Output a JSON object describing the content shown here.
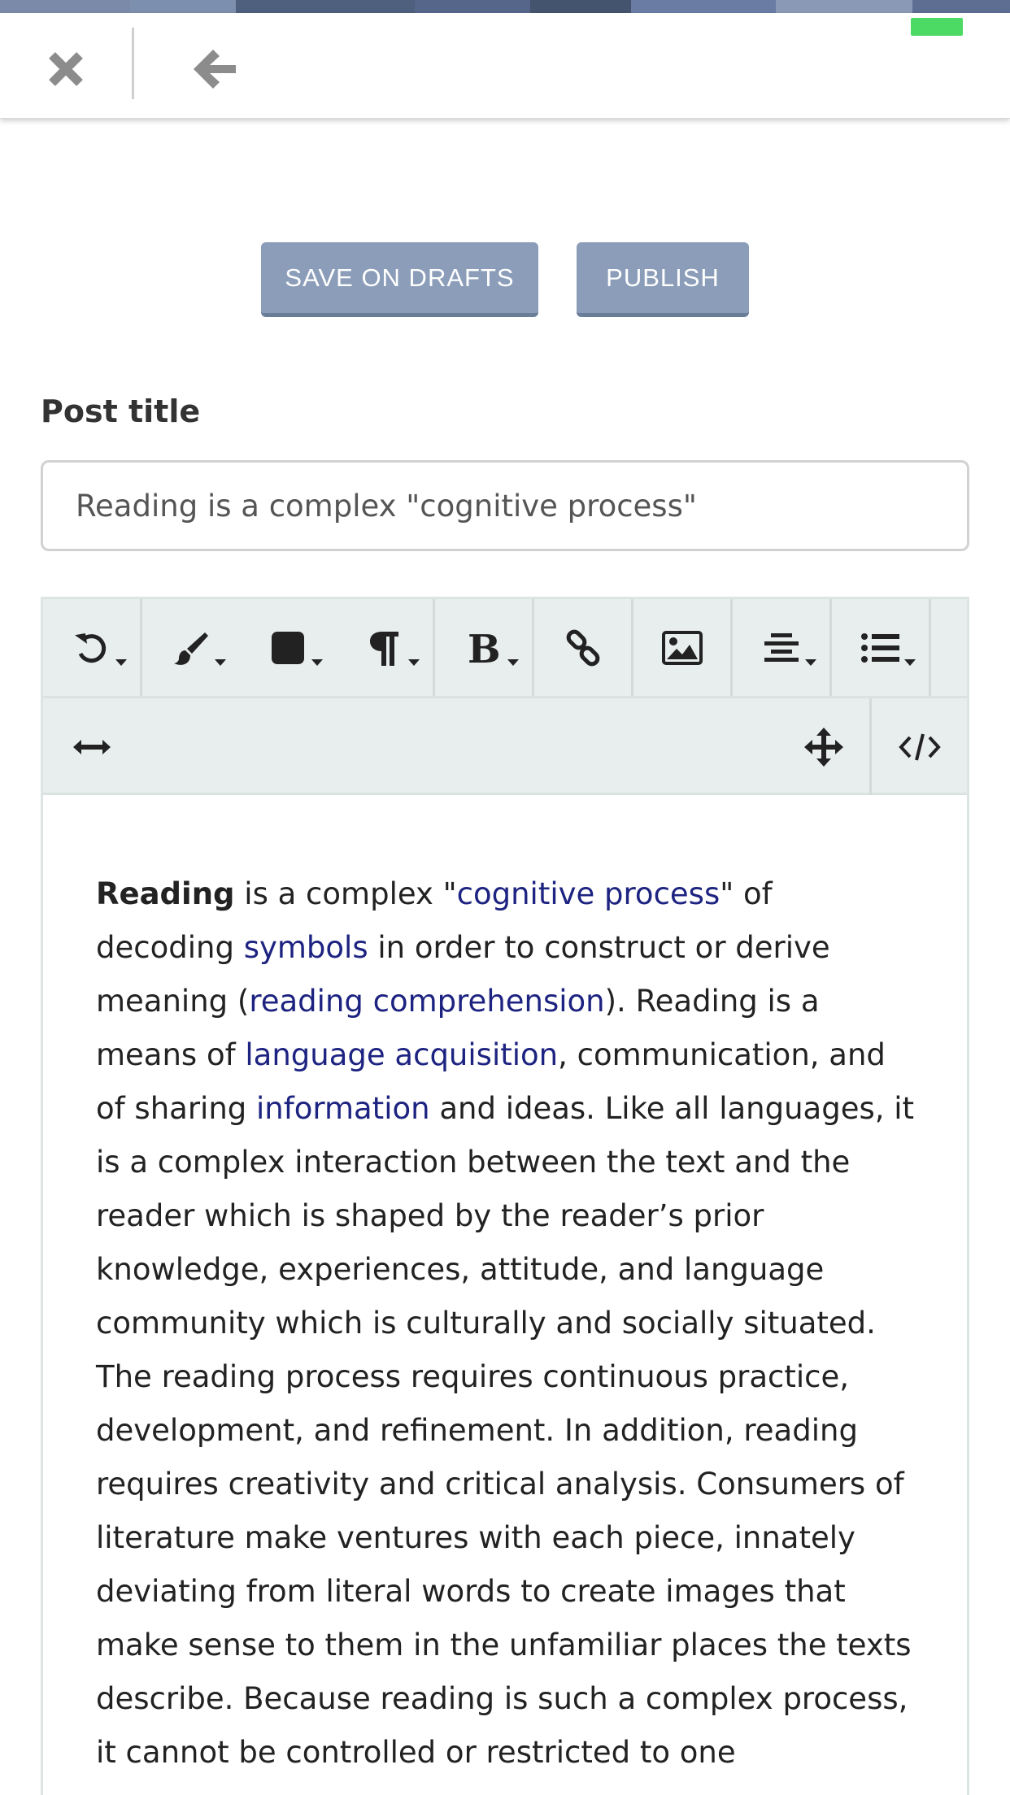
{
  "topstrip": {
    "colors": [
      "#7a8aa8",
      "#7d8fae",
      "#4f5f7e",
      "#56668a",
      "#44546f",
      "#6a7ca4",
      "#8a9ab6",
      "#5e6e92"
    ]
  },
  "header": {
    "close_icon": "close-icon",
    "back_icon": "arrow-left-icon"
  },
  "actions": {
    "save_drafts": "SAVE ON DRAFTS",
    "publish": "PUBLISH"
  },
  "form": {
    "post_title_label": "Post title",
    "post_title_value": "Reading is a complex \"cognitive process\""
  },
  "toolbar": {
    "row1": [
      "undo-icon",
      "brush-icon",
      "color-square-icon",
      "paragraph-icon",
      "bold-icon",
      "link-icon",
      "image-icon",
      "align-center-icon",
      "list-icon"
    ],
    "row2": [
      "expand-width-icon",
      "move-icon",
      "code-view-icon"
    ]
  },
  "content": {
    "s1": "Reading",
    "s2": " is a complex \"",
    "s3": "cognitive process",
    "s4": "\" of decoding ",
    "s5": "symbols",
    "s6": " in order to construct or derive meaning (",
    "s7": "reading comprehension",
    "s8": "). Reading is a means of ",
    "s9": "language acquisition",
    "s10": ", communication, and of sharing ",
    "s11": "information",
    "s12": " and ideas. Like all languages, it is a complex interaction between the text and the reader which is shaped by the reader’s prior knowledge, experiences, attitude, and language community which is culturally and socially situated. The reading process requires continuous practice, development, and refinement. In addition, reading requires creativity and critical analysis. Consumers of literature make ventures with each piece, innately deviating from literal words to create images that make sense to them in the unfamiliar places the texts describe. Because reading is such a complex process, it cannot be controlled or restricted to one"
  }
}
